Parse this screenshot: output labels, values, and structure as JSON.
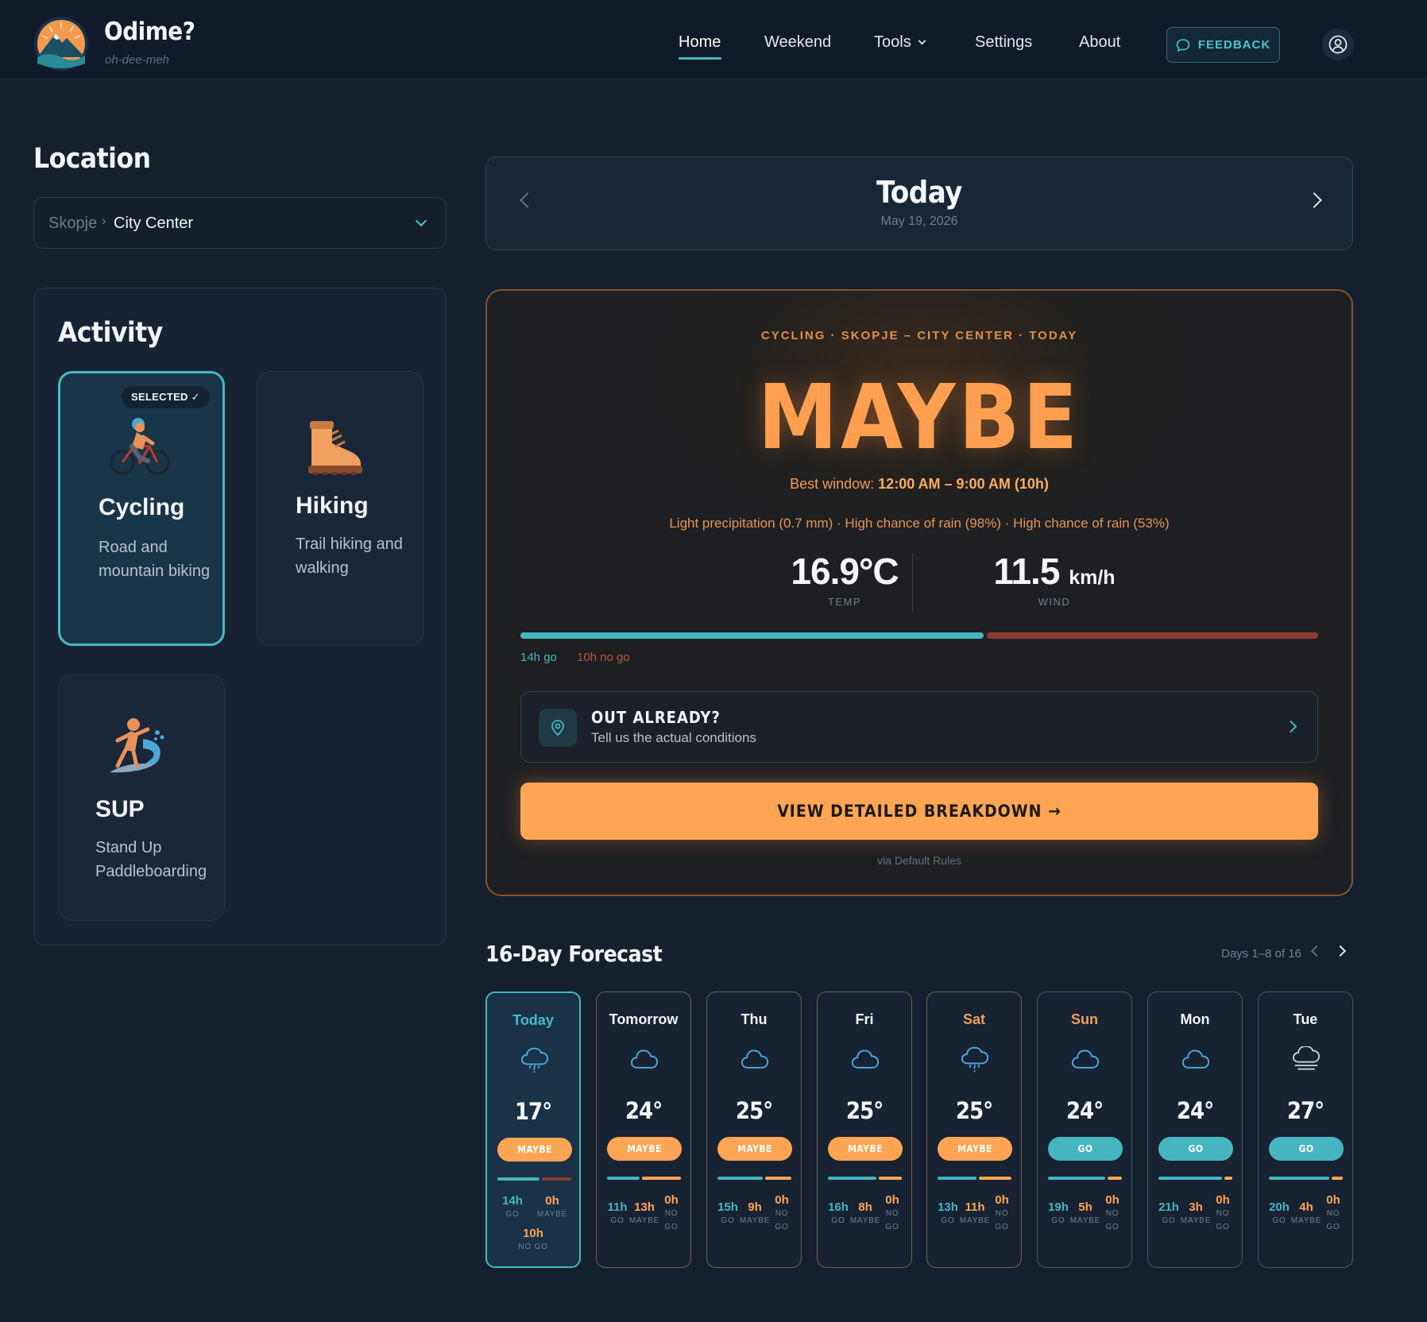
{
  "brand": {
    "name": "Odime?",
    "tagline": "oh-dee-meh"
  },
  "nav": {
    "home": "Home",
    "weekend": "Weekend",
    "tools": "Tools",
    "settings": "Settings",
    "about": "About",
    "feedback": "FEEDBACK"
  },
  "location": {
    "title": "Location",
    "city": "Skopje",
    "separator": "›",
    "area": "City Center"
  },
  "activity": {
    "title": "Activity",
    "selected_badge": "SELECTED ✓",
    "items": [
      {
        "name": "Cycling",
        "desc": "Road and mountain biking",
        "icon": "cyclist-icon",
        "selected": true
      },
      {
        "name": "Hiking",
        "desc": "Trail hiking and walking",
        "icon": "hiking-boot-icon",
        "selected": false
      },
      {
        "name": "SUP",
        "desc": "Stand Up Paddleboarding",
        "icon": "surfer-icon",
        "selected": false
      }
    ]
  },
  "date_nav": {
    "title": "Today",
    "date": "May 19, 2026"
  },
  "verdict": {
    "context": "CYCLING · SKOPJE – CITY CENTER · TODAY",
    "word": "MAYBE",
    "window_label": "Best window:",
    "window_value": "12:00 AM – 9:00 AM (10h)",
    "reasons": "Light precipitation (0.7 mm) · High chance of rain (98%) · High chance of rain (53%)",
    "temp": "16.9°C",
    "temp_label": "TEMP",
    "wind_value": "11.5",
    "wind_unit": "km/h",
    "wind_label": "WIND",
    "go_hours": 14,
    "nogo_hours": 10,
    "go_text": "14h go",
    "nogo_text": "10h no go",
    "out_title": "OUT ALREADY?",
    "out_sub": "Tell us the actual conditions",
    "cta": "VIEW DETAILED BREAKDOWN →",
    "via": "via Default Rules"
  },
  "forecast": {
    "title": "16-Day Forecast",
    "range": "Days 1–8 of 16",
    "labels": {
      "go": "GO",
      "maybe": "MAYBE",
      "nogo1": "NO",
      "nogo2": "GO",
      "nogo_inline": "NO GO"
    },
    "days": [
      {
        "name": "Today",
        "icon": "cloud-rain-icon",
        "temp": "17°",
        "verdict": "MAYBE",
        "go": "14h",
        "maybe": "0h",
        "nogo": "10h"
      },
      {
        "name": "Tomorrow",
        "icon": "cloud-icon",
        "temp": "24°",
        "verdict": "MAYBE",
        "go": "11h",
        "maybe": "13h",
        "nogo": "0h"
      },
      {
        "name": "Thu",
        "icon": "cloud-icon",
        "temp": "25°",
        "verdict": "MAYBE",
        "go": "15h",
        "maybe": "9h",
        "nogo": "0h"
      },
      {
        "name": "Fri",
        "icon": "cloud-icon",
        "temp": "25°",
        "verdict": "MAYBE",
        "go": "16h",
        "maybe": "8h",
        "nogo": "0h"
      },
      {
        "name": "Sat",
        "icon": "cloud-rain-icon",
        "temp": "25°",
        "verdict": "MAYBE",
        "go": "13h",
        "maybe": "11h",
        "nogo": "0h"
      },
      {
        "name": "Sun",
        "icon": "cloud-icon",
        "temp": "24°",
        "verdict": "GO",
        "go": "19h",
        "maybe": "5h",
        "nogo": "0h"
      },
      {
        "name": "Mon",
        "icon": "cloud-icon",
        "temp": "24°",
        "verdict": "GO",
        "go": "21h",
        "maybe": "3h",
        "nogo": "0h"
      },
      {
        "name": "Tue",
        "icon": "cloud-fog-icon",
        "temp": "27°",
        "verdict": "GO",
        "go": "20h",
        "maybe": "4h",
        "nogo": "0h"
      }
    ]
  },
  "colors": {
    "accent": "#46b8c2",
    "maybe": "#ffa553",
    "nogo": "#8c3b30",
    "background": "#15202f"
  }
}
